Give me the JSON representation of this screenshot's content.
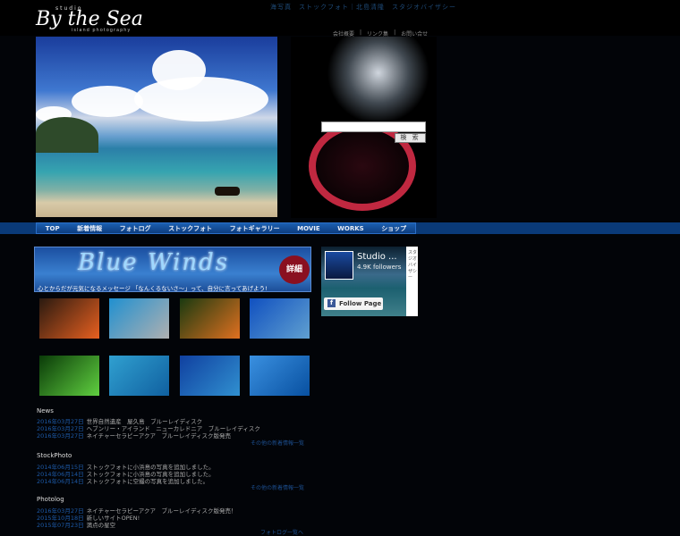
{
  "header": {
    "logo_small": "studio",
    "logo": "By the Sea",
    "logo_sub": "island photography",
    "tagline": "海写真　ストックフォト｜北島清隆　スタジオバイザシー",
    "sublinks": [
      "会社概要",
      "|",
      "リンク集",
      "|",
      "お問い合せ"
    ]
  },
  "search": {
    "placeholder": "",
    "button": "検 索"
  },
  "nav": [
    "TOP",
    "新着情報",
    "フォトログ",
    "ストックフォト",
    "フォトギャラリー",
    "MOVIE",
    "WORKS",
    "ショップ"
  ],
  "banner": {
    "title": "Blue Winds",
    "detail": "詳細",
    "message": "心とからだが元気になるメッセージ 「なんくるないさ〜」って、自分に言ってあげよう!"
  },
  "thumbnails": [
    {
      "subject": "clownfish",
      "colors": [
        "#2a1a10",
        "#e86020"
      ]
    },
    {
      "subject": "road-to-sea",
      "colors": [
        "#2090d0",
        "#b0b0b0"
      ]
    },
    {
      "subject": "bird-of-paradise-flower",
      "colors": [
        "#1a3a10",
        "#e07020"
      ]
    },
    {
      "subject": "sea-horizon",
      "colors": [
        "#1050c0",
        "#60a0d0"
      ]
    },
    {
      "subject": "green-frog",
      "colors": [
        "#0a3a08",
        "#60d040"
      ]
    },
    {
      "subject": "shallow-sea",
      "colors": [
        "#30a0d0",
        "#1060a0"
      ]
    },
    {
      "subject": "sea-aerial",
      "colors": [
        "#1040a0",
        "#3090d0"
      ]
    },
    {
      "subject": "windsurfer",
      "colors": [
        "#3a90e0",
        "#0850a0"
      ]
    }
  ],
  "facebook": {
    "name": "Studio ...",
    "followers": "4.9K followers",
    "follow": "Follow Page",
    "side": "スタジオバイザシー"
  },
  "news": {
    "title": "News",
    "items": [
      {
        "date": "2016年03月27日",
        "text": "世界自然遺産　屋久島　ブルーレイディスク"
      },
      {
        "date": "2016年03月27日",
        "text": "ヘブンリー・アイランド　ニューカレドニア　ブルーレイディスク"
      },
      {
        "date": "2016年03月27日",
        "text": "ネイチャーセラピーアクア　ブルーレイディスク版発売"
      }
    ],
    "more": "その他の新着情報一覧"
  },
  "stock": {
    "title": "StockPhoto",
    "items": [
      {
        "date": "2014年06月15日",
        "text": "ストックフォトに小浜島の写真を追加しました。"
      },
      {
        "date": "2014年06月14日",
        "text": "ストックフォトに小浜島の写真を追加しました。"
      },
      {
        "date": "2014年06月14日",
        "text": "ストックフォトに空撮の写真を追加しました。"
      }
    ],
    "more": "その他の新着情報一覧"
  },
  "photolog": {
    "title": "Photolog",
    "items": [
      {
        "date": "2016年03月27日",
        "text": "ネイチャーセラピーアクア　ブルーレイディスク版発売！"
      },
      {
        "date": "2015年10月18日",
        "text": "新しいサイトOPEN!"
      },
      {
        "date": "2015年07月23日",
        "text": "満点の星空"
      }
    ],
    "more": "フォトログ一覧へ"
  }
}
